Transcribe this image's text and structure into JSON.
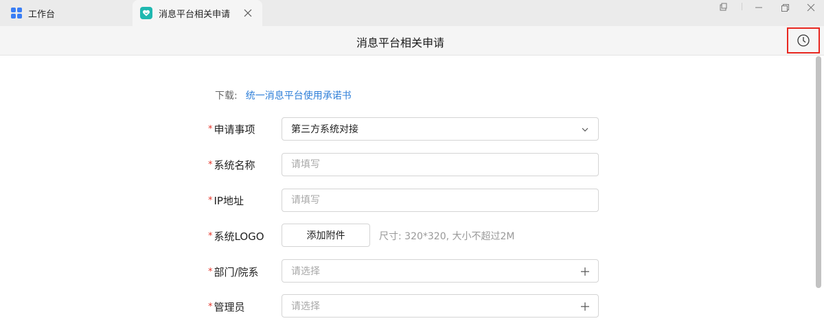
{
  "tabs": [
    {
      "label": "工作台",
      "icon": "workbench-grid-icon"
    },
    {
      "label": "消息平台相关申请",
      "icon": "app-heart-icon"
    }
  ],
  "window_controls": [
    "pin-window-icon",
    "minimize-icon",
    "restore-icon",
    "close-icon"
  ],
  "header": {
    "title": "消息平台相关申请",
    "history_icon": "clock-icon"
  },
  "download": {
    "label": "下载:",
    "link_text": "统一消息平台使用承诺书"
  },
  "form": {
    "required_mark": "*",
    "application_item": {
      "label": "申请事项",
      "value": "第三方系统对接"
    },
    "system_name": {
      "label": "系统名称",
      "placeholder": "请填写"
    },
    "ip_address": {
      "label": "IP地址",
      "placeholder": "请填写"
    },
    "system_logo": {
      "label": "系统LOGO",
      "button": "添加附件",
      "hint": "尺寸: 320*320, 大小不超过2M"
    },
    "department": {
      "label": "部门/院系",
      "placeholder": "请选择"
    },
    "admin": {
      "label": "管理员",
      "placeholder": "请选择"
    }
  },
  "colors": {
    "accent": "#2f7fd8",
    "required": "#e4352a",
    "highlight_box": "#e8261f",
    "app_icon": "#1fb8b0"
  }
}
